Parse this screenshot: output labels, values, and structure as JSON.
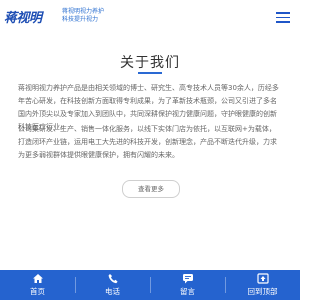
{
  "header": {
    "logo_text_main": "蒋视明",
    "logo_sub_1": "蒋视明视力养护",
    "logo_sub_2": "科技提升视力"
  },
  "about": {
    "title": "关于我们",
    "paragraph_1": "蒋视明视力养护产品是由相关领域的博士、研究生、高专技术人员等30余人，历经多年苦心研发，在科技创新方面取得专利成果，为了革新技术瓶颈，公司又引进了多名国内外顶尖以及专家加入到团队中，共同深耕保护视力健康问题，守护眼健康的创新科技医疗行业。",
    "paragraph_2": "公司集研发、生产、销售一体化服务，以线下实体门店为依托，以互联网+为载体，打造闭环产业链，运用电工大先进的科技开发，创新理念，产品不断迭代升级，力求为更多弱视群体提供眼健康保护，拥有闪耀的未来。",
    "more_button": "查看更多"
  },
  "bottom_nav": {
    "items": [
      {
        "label": "首页",
        "icon": "home-icon"
      },
      {
        "label": "电话",
        "icon": "phone-icon"
      },
      {
        "label": "留言",
        "icon": "message-icon"
      },
      {
        "label": "回到顶部",
        "icon": "back-to-top-icon"
      }
    ]
  },
  "colors": {
    "accent": "#2563cf",
    "brand": "#1f4fb4"
  }
}
